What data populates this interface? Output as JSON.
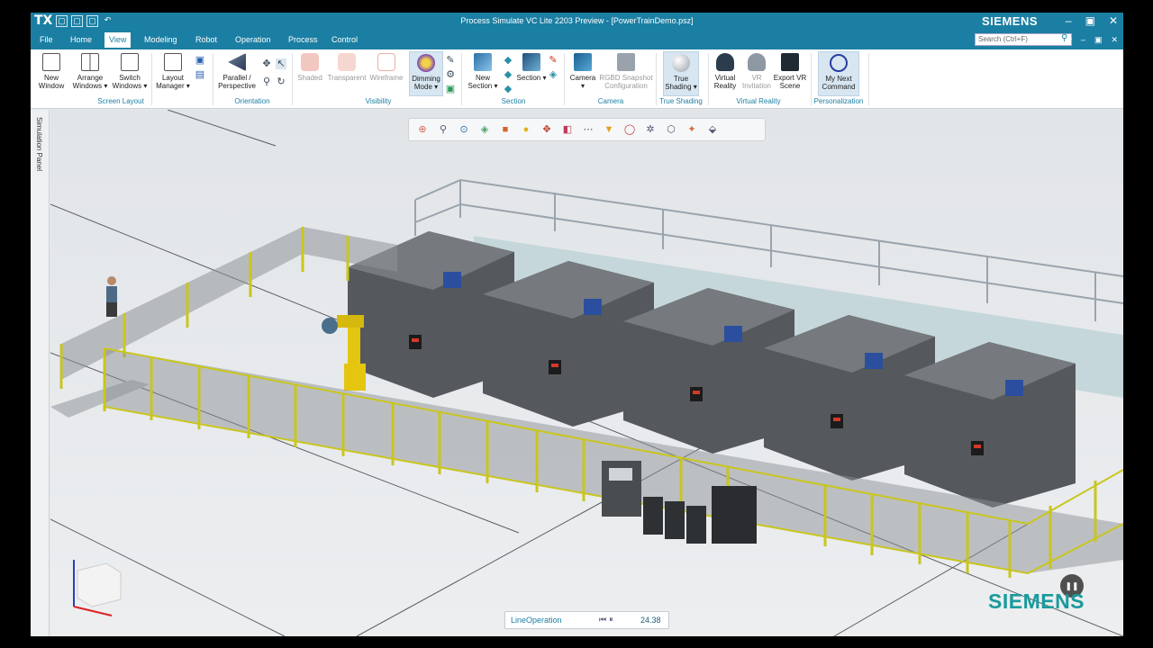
{
  "titlebar": {
    "app_logo": "TX",
    "title": "Process Simulate VC Lite 2203 Preview - [PowerTrainDemo.psz]",
    "brand": "SIEMENS"
  },
  "menu": {
    "tabs": [
      {
        "label": "File"
      },
      {
        "label": "Home"
      },
      {
        "label": "View"
      },
      {
        "label": "Modeling"
      },
      {
        "label": "Robot"
      },
      {
        "label": "Operation"
      },
      {
        "label": "Process"
      },
      {
        "label": "Control"
      }
    ],
    "search_placeholder": "Search (Ctrl+F)"
  },
  "ribbon": {
    "buttons": {
      "new_window": "New Window",
      "arrange_windows": "Arrange Windows ▾",
      "switch_windows": "Switch Windows ▾",
      "layout_manager": "Layout Manager ▾",
      "parallel_perspective": "Parallel / Perspective",
      "shaded": "Shaded",
      "transparent": "Transparent",
      "wireframe": "Wireframe",
      "dimming_mode": "Dimming Mode ▾",
      "new_section": "New Section ▾",
      "section": "Section ▾",
      "camera": "Camera ▾",
      "rgbd_snapshot": "RGBD Snapshot Configuration",
      "true_shading": "True Shading ▾",
      "virtual_reality": "Virtual Reality",
      "vr_invitation": "VR Invitation",
      "export_vr_scene": "Export VR Scene",
      "my_next_command": "My Next Command"
    },
    "groups": {
      "screen_layout": "Screen Layout",
      "orientation": "Orientation",
      "visibility": "Visibility",
      "section": "Section",
      "camera": "Camera",
      "true_shading": "True Shading",
      "virtual_reality": "Virtual Reality",
      "personalization": "Personalization"
    }
  },
  "side_panel": {
    "label": "Simulation Panel"
  },
  "playback": {
    "operation": "LineOperation",
    "time": "24.38"
  },
  "watermark": "SIEMENS",
  "colors": {
    "title_bar": "#1b7fa3",
    "accent_teal": "#1a9a9c",
    "fence_yellow": "#c9c61e",
    "machine_gray": "#5a5d61",
    "robot_yellow": "#e4c50f"
  }
}
